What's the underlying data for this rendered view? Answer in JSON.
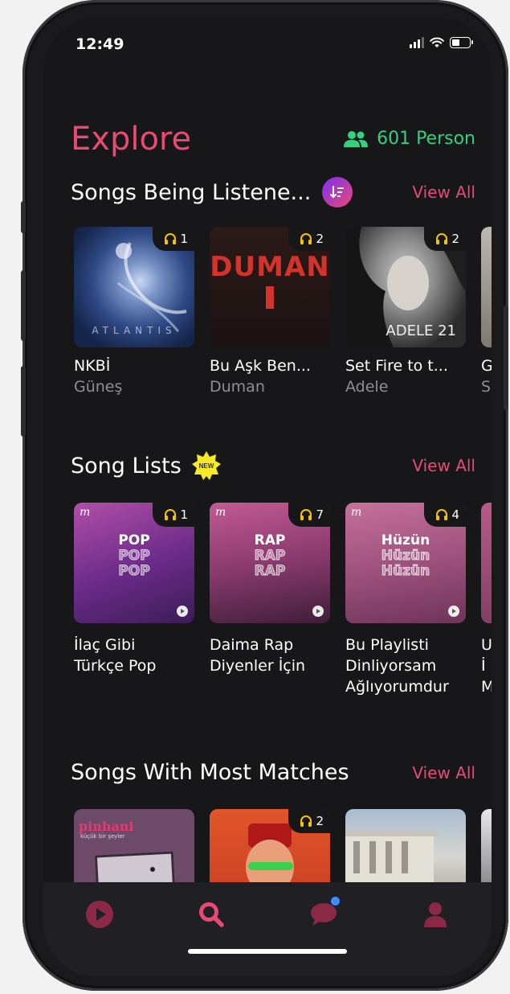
{
  "status_bar": {
    "time": "12:49"
  },
  "header": {
    "title": "Explore",
    "person_count": "601 Person"
  },
  "sections": {
    "listening": {
      "title": "Songs Being Listene...",
      "view_all": "View All",
      "items": [
        {
          "title": "NKBİ",
          "artist": "Güneş",
          "listeners": "1",
          "art_text": "ATLANTIS"
        },
        {
          "title": "Bu Aşk Ben...",
          "artist": "Duman",
          "listeners": "2",
          "art_text": "DUMAN"
        },
        {
          "title": "Set Fire to t...",
          "artist": "Adele",
          "listeners": "2",
          "art_text": "ADELE 21"
        },
        {
          "title": "G",
          "artist": "S"
        }
      ]
    },
    "song_lists": {
      "title": "Song Lists",
      "badge": "NEW",
      "view_all": "View All",
      "items": [
        {
          "genre": "POP",
          "title_line1": "İlaç Gibi",
          "title_line2": "Türkçe Pop",
          "title_line3": "",
          "listeners": "1"
        },
        {
          "genre": "RAP",
          "title_line1": "Daima Rap",
          "title_line2": "Diyenler İçin",
          "title_line3": "",
          "listeners": "7"
        },
        {
          "genre": "Hüzün",
          "title_line1": "Bu Playlisti",
          "title_line2": "Dinliyorsam",
          "title_line3": "Ağlıyorumdur",
          "listeners": "4"
        },
        {
          "title_line1": "U",
          "title_line2": "İ",
          "title_line3": "M"
        }
      ]
    },
    "matches": {
      "title": "Songs With Most Matches",
      "view_all": "View All",
      "items": [
        {
          "art_text": "pinhani",
          "art_subtext": "küçük bir şeyler"
        },
        {
          "listeners": "2"
        },
        {},
        {}
      ]
    }
  },
  "colors": {
    "accent": "#e94a73",
    "green": "#35d07f",
    "background": "#17171a",
    "tabbar": "#202024"
  },
  "tabbar_icons": [
    "play-icon",
    "search-icon",
    "chat-icon",
    "profile-icon"
  ]
}
